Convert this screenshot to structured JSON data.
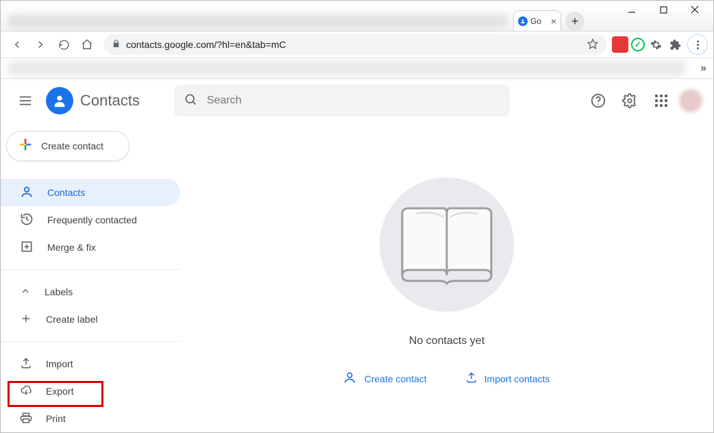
{
  "window": {
    "tab": {
      "title": "Go"
    }
  },
  "browser": {
    "url": "contacts.google.com/?hl=en&tab=mC"
  },
  "app": {
    "title": "Contacts",
    "search_placeholder": "Search",
    "create_button": "Create contact"
  },
  "sidebar": {
    "items": [
      {
        "label": "Contacts",
        "icon": "person-icon",
        "selected": true
      },
      {
        "label": "Frequently contacted",
        "icon": "history-icon"
      },
      {
        "label": "Merge & fix",
        "icon": "merge-icon"
      }
    ],
    "labels_header": "Labels",
    "create_label": "Create label",
    "tools": [
      {
        "label": "Import",
        "icon": "upload-icon",
        "highlighted": true
      },
      {
        "label": "Export",
        "icon": "cloud-download-icon"
      },
      {
        "label": "Print",
        "icon": "print-icon"
      }
    ]
  },
  "empty_state": {
    "message": "No contacts yet",
    "create": "Create contact",
    "import": "Import contacts"
  }
}
